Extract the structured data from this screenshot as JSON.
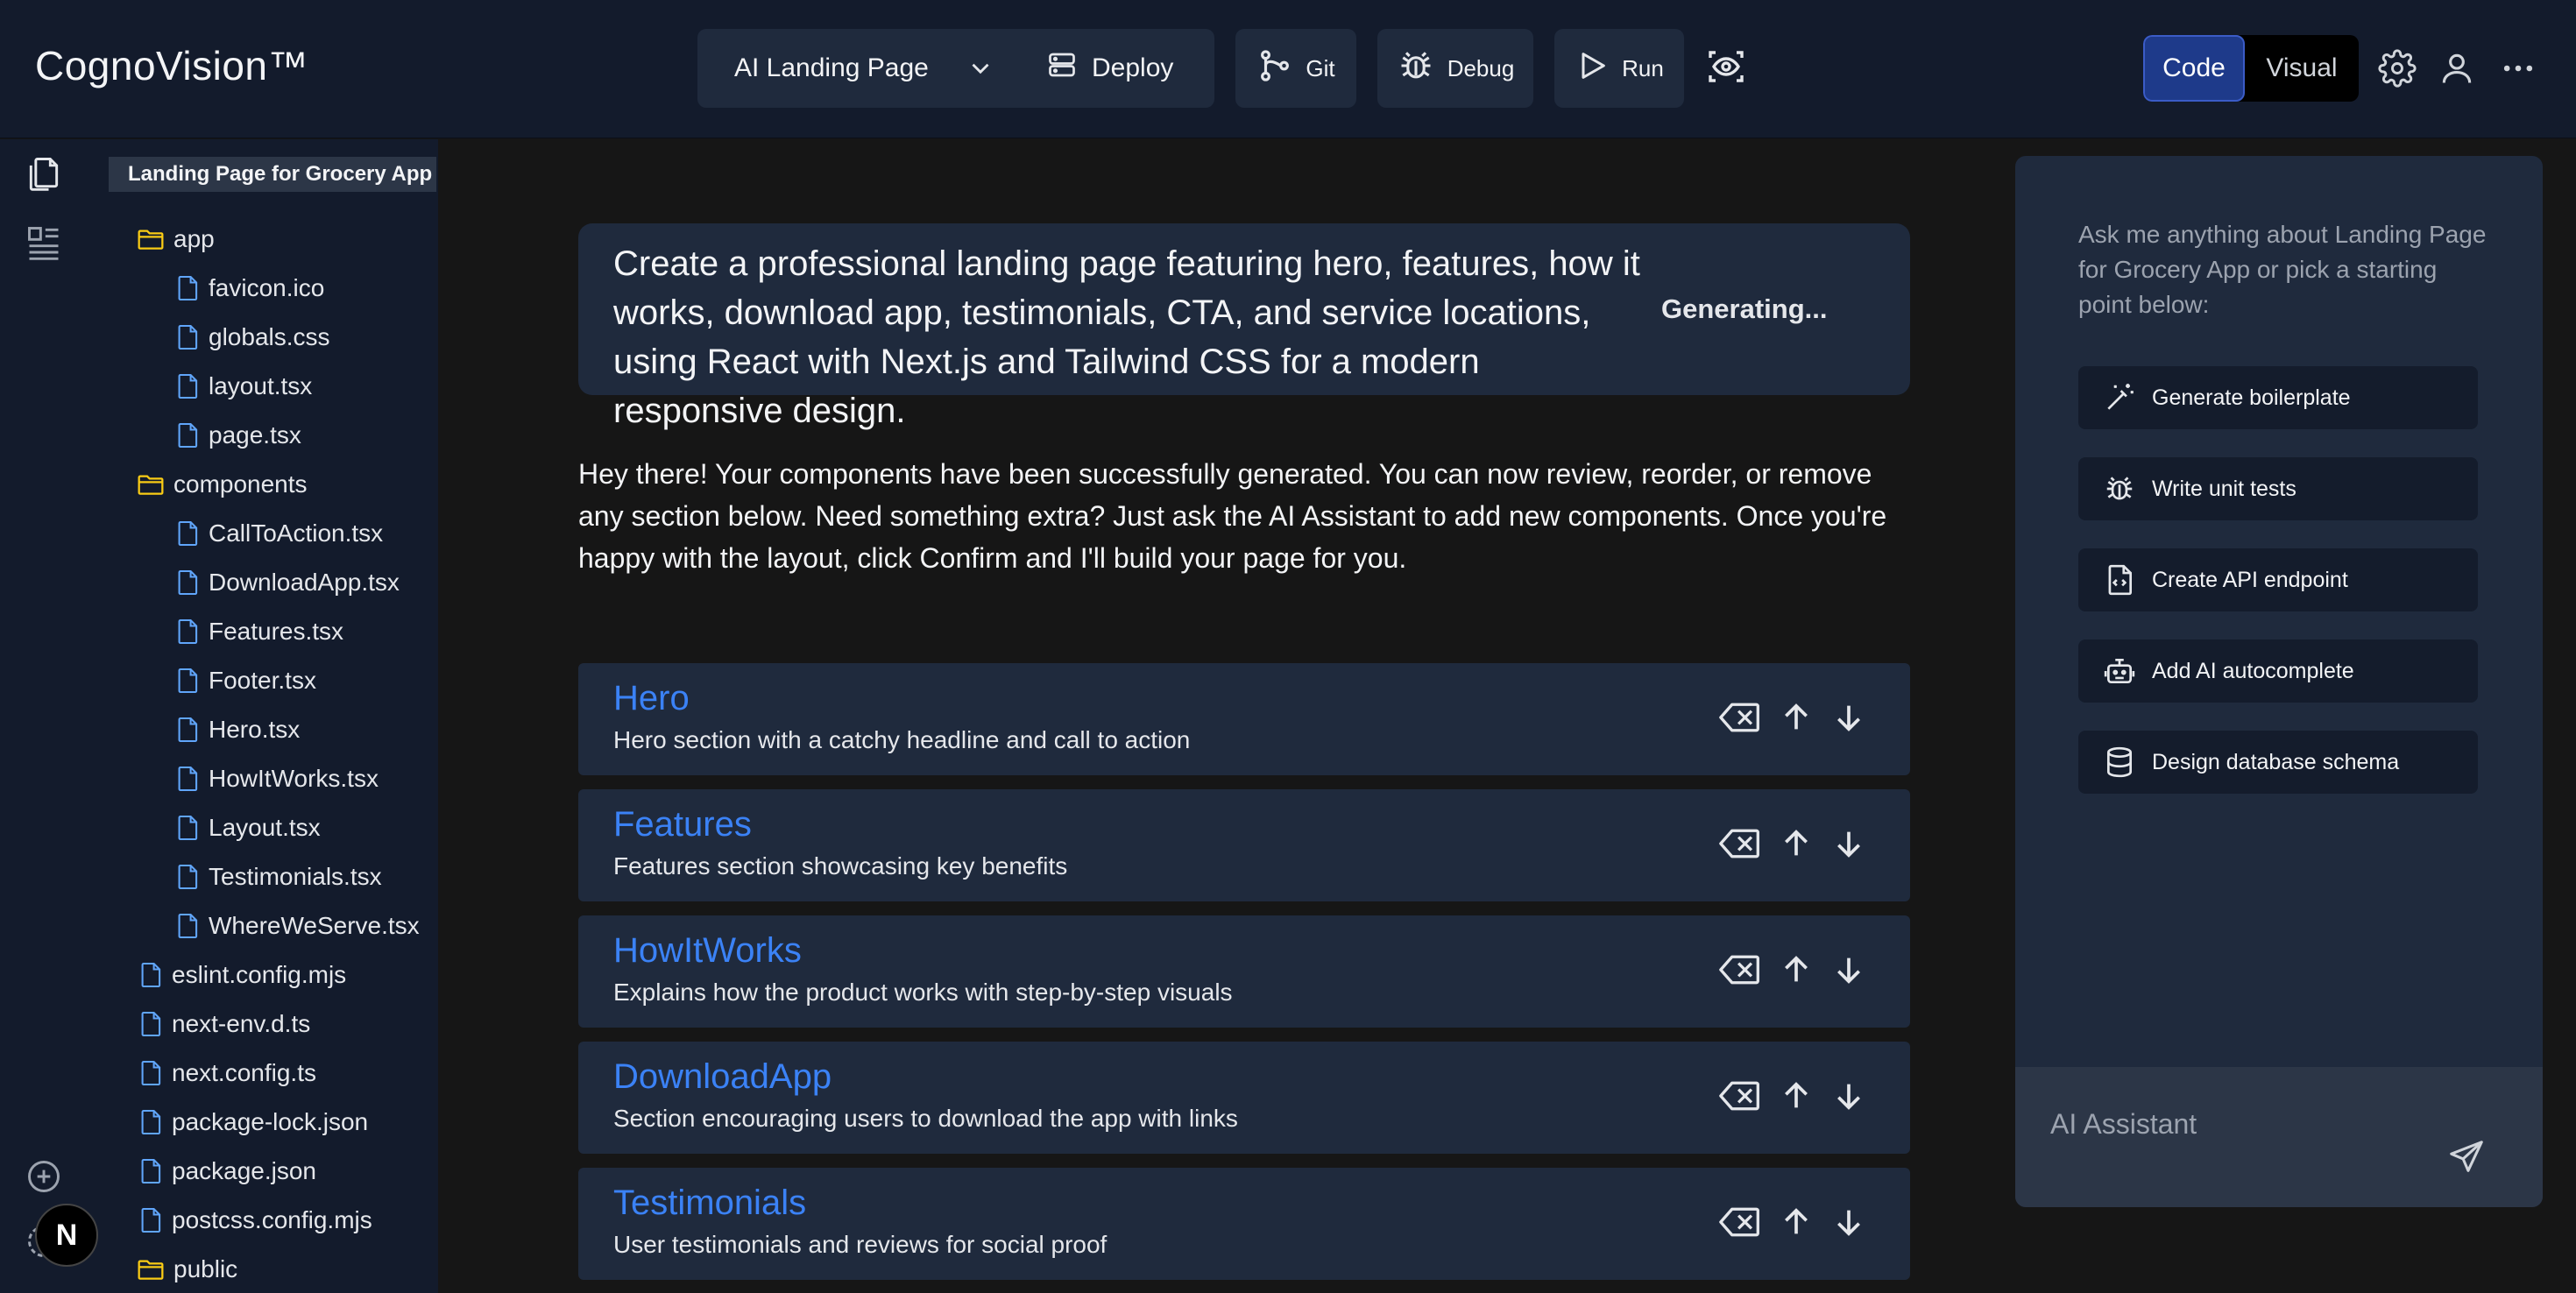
{
  "app": {
    "brand": "CognoVision™"
  },
  "toolbar": {
    "project": "AI Landing Page",
    "deploy_label": "Deploy",
    "git_label": "Git",
    "debug_label": "Debug",
    "run_label": "Run",
    "mode_code": "Code",
    "mode_visual": "Visual",
    "active_mode": "Code"
  },
  "explorer": {
    "root": "Landing Page for Grocery App",
    "items": [
      {
        "name": "app",
        "type": "folder",
        "depth": 0
      },
      {
        "name": "favicon.ico",
        "type": "file",
        "depth": 1
      },
      {
        "name": "globals.css",
        "type": "file",
        "depth": 1
      },
      {
        "name": "layout.tsx",
        "type": "file",
        "depth": 1
      },
      {
        "name": "page.tsx",
        "type": "file",
        "depth": 1
      },
      {
        "name": "components",
        "type": "folder",
        "depth": 0
      },
      {
        "name": "CallToAction.tsx",
        "type": "file",
        "depth": 1
      },
      {
        "name": "DownloadApp.tsx",
        "type": "file",
        "depth": 1
      },
      {
        "name": "Features.tsx",
        "type": "file",
        "depth": 1
      },
      {
        "name": "Footer.tsx",
        "type": "file",
        "depth": 1
      },
      {
        "name": "Hero.tsx",
        "type": "file",
        "depth": 1
      },
      {
        "name": "HowItWorks.tsx",
        "type": "file",
        "depth": 1
      },
      {
        "name": "Layout.tsx",
        "type": "file",
        "depth": 1
      },
      {
        "name": "Testimonials.tsx",
        "type": "file",
        "depth": 1
      },
      {
        "name": "WhereWeServe.tsx",
        "type": "file",
        "depth": 1
      },
      {
        "name": "eslint.config.mjs",
        "type": "file",
        "depth": 0
      },
      {
        "name": "next-env.d.ts",
        "type": "file",
        "depth": 0
      },
      {
        "name": "next.config.ts",
        "type": "file",
        "depth": 0
      },
      {
        "name": "package-lock.json",
        "type": "file",
        "depth": 0
      },
      {
        "name": "package.json",
        "type": "file",
        "depth": 0
      },
      {
        "name": "postcss.config.mjs",
        "type": "file",
        "depth": 0
      },
      {
        "name": "public",
        "type": "folder",
        "depth": 0
      }
    ]
  },
  "main": {
    "prompt": "Create a professional landing page featuring hero, features, how it works, download app, testimonials, CTA, and service locations, using React with Next.js and Tailwind CSS for a modern responsive design.",
    "status": "Generating...",
    "message": "Hey there! Your components have been successfully generated. You can now review, reorder, or remove any section below. Need something extra? Just ask the AI Assistant to add new components. Once you're happy with the layout, click Confirm and I'll build your page for you.",
    "components": [
      {
        "title": "Hero",
        "description": "Hero section with a catchy headline and call to action"
      },
      {
        "title": "Features",
        "description": "Features section showcasing key benefits"
      },
      {
        "title": "HowItWorks",
        "description": "Explains how the product works with step-by-step visuals"
      },
      {
        "title": "DownloadApp",
        "description": "Section encouraging users to download the app with links"
      },
      {
        "title": "Testimonials",
        "description": "User testimonials and reviews for social proof"
      }
    ]
  },
  "assistant": {
    "intro": "Ask me anything about Landing Page for Grocery App or pick a starting point below:",
    "suggestions": [
      {
        "label": "Generate boilerplate",
        "icon": "magic-wand-icon"
      },
      {
        "label": "Write unit tests",
        "icon": "bug-icon"
      },
      {
        "label": "Create API endpoint",
        "icon": "code-file-icon"
      },
      {
        "label": "Add AI autocomplete",
        "icon": "robot-icon"
      },
      {
        "label": "Design database schema",
        "icon": "database-icon"
      }
    ],
    "input_placeholder": "AI Assistant"
  },
  "badge": {
    "label": "N"
  }
}
